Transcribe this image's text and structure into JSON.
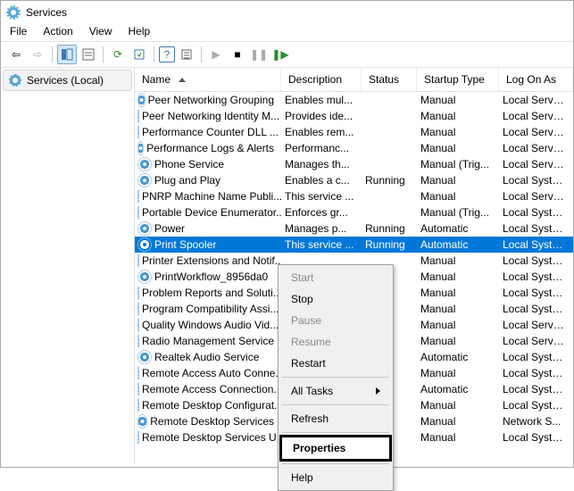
{
  "title": "Services",
  "menu": {
    "file": "File",
    "action": "Action",
    "view": "View",
    "help": "Help"
  },
  "leftPane": {
    "root": "Services (Local)"
  },
  "columns": {
    "name": "Name",
    "desc": "Description",
    "status": "Status",
    "startup": "Startup Type",
    "logon": "Log On As"
  },
  "rows": [
    {
      "name": "Peer Networking Grouping",
      "desc": "Enables mul...",
      "status": "",
      "startup": "Manual",
      "logon": "Local Service"
    },
    {
      "name": "Peer Networking Identity M...",
      "desc": "Provides ide...",
      "status": "",
      "startup": "Manual",
      "logon": "Local Service"
    },
    {
      "name": "Performance Counter DLL ...",
      "desc": "Enables rem...",
      "status": "",
      "startup": "Manual",
      "logon": "Local Service"
    },
    {
      "name": "Performance Logs & Alerts",
      "desc": "Performanc...",
      "status": "",
      "startup": "Manual",
      "logon": "Local Service"
    },
    {
      "name": "Phone Service",
      "desc": "Manages th...",
      "status": "",
      "startup": "Manual (Trig...",
      "logon": "Local Service"
    },
    {
      "name": "Plug and Play",
      "desc": "Enables a c...",
      "status": "Running",
      "startup": "Manual",
      "logon": "Local Syste..."
    },
    {
      "name": "PNRP Machine Name Publi...",
      "desc": "This service ...",
      "status": "",
      "startup": "Manual",
      "logon": "Local Service"
    },
    {
      "name": "Portable Device Enumerator...",
      "desc": "Enforces gr...",
      "status": "",
      "startup": "Manual (Trig...",
      "logon": "Local Syste..."
    },
    {
      "name": "Power",
      "desc": "Manages p...",
      "status": "Running",
      "startup": "Automatic",
      "logon": "Local Syste..."
    },
    {
      "name": "Print Spooler",
      "desc": "This service ...",
      "status": "Running",
      "startup": "Automatic",
      "logon": "Local Syste...",
      "selected": true
    },
    {
      "name": "Printer Extensions and Notif...",
      "desc": "",
      "status": "",
      "startup": "Manual",
      "logon": "Local Syste..."
    },
    {
      "name": "PrintWorkflow_8956da0",
      "desc": "",
      "status": "",
      "startup": "Manual",
      "logon": "Local Syste..."
    },
    {
      "name": "Problem Reports and Soluti...",
      "desc": "",
      "status": "",
      "startup": "Manual",
      "logon": "Local Syste..."
    },
    {
      "name": "Program Compatibility Assi...",
      "desc": "",
      "status": "",
      "startup": "Manual",
      "logon": "Local Syste..."
    },
    {
      "name": "Quality Windows Audio Vid...",
      "desc": "",
      "status": "",
      "startup": "Manual",
      "logon": "Local Service"
    },
    {
      "name": "Radio Management Service",
      "desc": "",
      "status": "",
      "startup": "Manual",
      "logon": "Local Service"
    },
    {
      "name": "Realtek Audio Service",
      "desc": "",
      "status": "",
      "startup": "Automatic",
      "logon": "Local Syste..."
    },
    {
      "name": "Remote Access Auto Conne...",
      "desc": "",
      "status": "",
      "startup": "Manual",
      "logon": "Local Syste..."
    },
    {
      "name": "Remote Access Connection...",
      "desc": "",
      "status": "",
      "startup": "Automatic",
      "logon": "Local Syste..."
    },
    {
      "name": "Remote Desktop Configurat...",
      "desc": "",
      "status": "",
      "startup": "Manual",
      "logon": "Local Syste..."
    },
    {
      "name": "Remote Desktop Services",
      "desc": "",
      "status": "",
      "startup": "Manual",
      "logon": "Network S..."
    },
    {
      "name": "Remote Desktop Services U...",
      "desc": "",
      "status": "",
      "startup": "Manual",
      "logon": "Local Syste..."
    }
  ],
  "contextMenu": {
    "start": "Start",
    "stop": "Stop",
    "pause": "Pause",
    "resume": "Resume",
    "restart": "Restart",
    "allTasks": "All Tasks",
    "refresh": "Refresh",
    "properties": "Properties",
    "help": "Help"
  }
}
